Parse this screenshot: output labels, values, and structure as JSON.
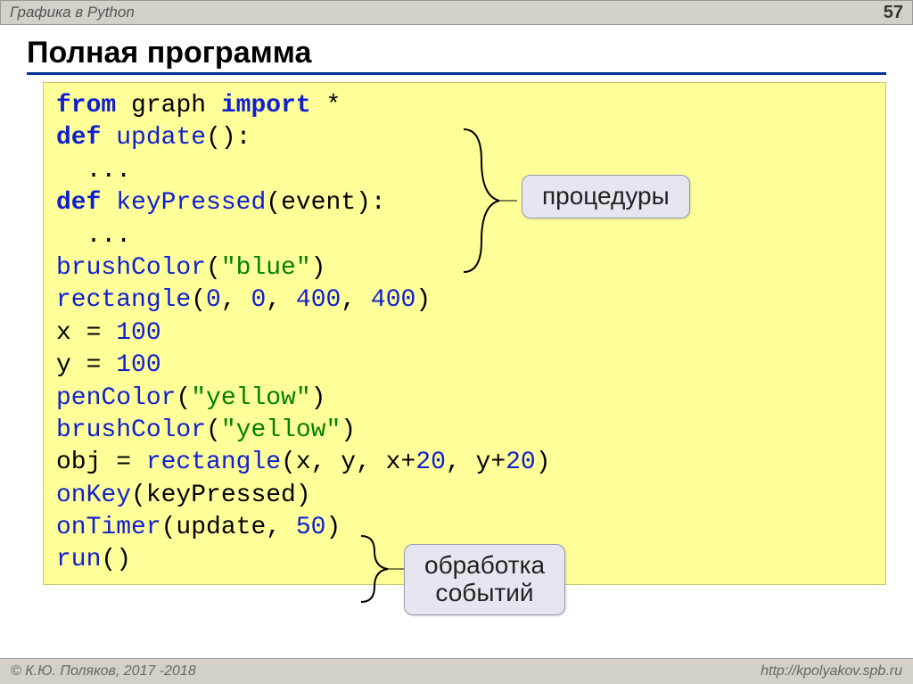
{
  "header": {
    "topic": "Графика в Python",
    "page_number": "57"
  },
  "title": "Полная программа",
  "code": {
    "l1_from": "from",
    "l1_mod": "graph",
    "l1_import": "import",
    "l1_star": "*",
    "l2_def": "def",
    "l2_fn": "update",
    "l2_paren": "():",
    "l3_body": "  ...",
    "l4_def": "def",
    "l4_fn": "keyPressed",
    "l4_paren": "(event):",
    "l5_body": "  ...",
    "l6_fn": "brushColor",
    "l6_open": "(",
    "l6_arg": "\"blue\"",
    "l6_close": ")",
    "l7_fn": "rectangle",
    "l7_open": "(",
    "l7_a1": "0",
    "l7_c1": ", ",
    "l7_a2": "0",
    "l7_c2": ", ",
    "l7_a3": "400",
    "l7_c3": ", ",
    "l7_a4": "400",
    "l7_close": ")",
    "l8_var": "x = ",
    "l8_val": "100",
    "l9_var": "y = ",
    "l9_val": "100",
    "l10_fn": "penColor",
    "l10_open": "(",
    "l10_arg": "\"yellow\"",
    "l10_close": ")",
    "l11_fn": "brushColor",
    "l11_open": "(",
    "l11_arg": "\"yellow\"",
    "l11_close": ")",
    "l12_lhs": "obj = ",
    "l12_fn": "rectangle",
    "l12_open": "(x, y, x+",
    "l12_n1": "20",
    "l12_mid": ", y+",
    "l12_n2": "20",
    "l12_close": ")",
    "l13_fn": "onKey",
    "l13_args": "(keyPressed)",
    "l14_fn": "onTimer",
    "l14_open": "(update, ",
    "l14_n": "50",
    "l14_close": ")",
    "l15_fn": "run",
    "l15_args": "()"
  },
  "callouts": {
    "procedures": "процедуры",
    "events_l1": "обработка",
    "events_l2": "событий"
  },
  "footer": {
    "copyright": "© К.Ю. Поляков, 2017 -2018",
    "url": "http://kpolyakov.spb.ru"
  }
}
